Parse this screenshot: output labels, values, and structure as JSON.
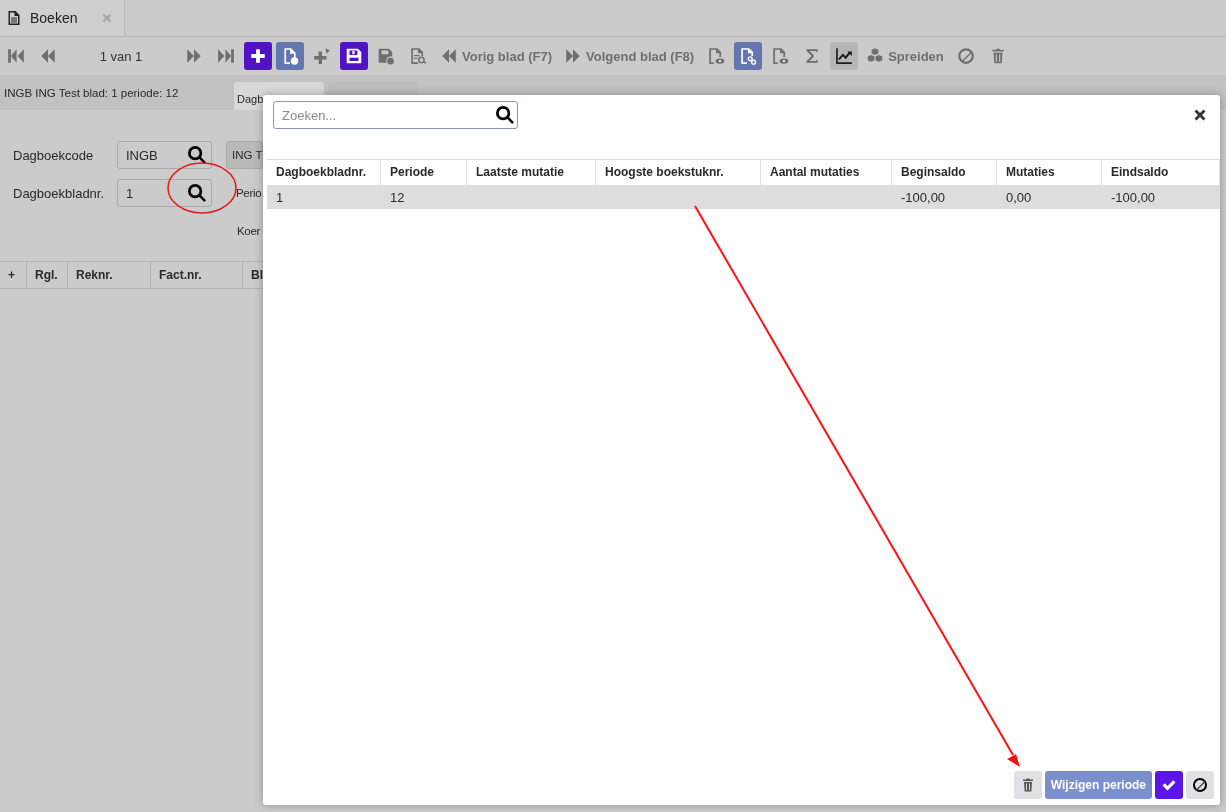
{
  "tab": {
    "label": "Boeken"
  },
  "toolbar": [
    {
      "kind": "icon",
      "disabled": true
    },
    {
      "kind": "icon",
      "disabled": true
    },
    {
      "kind": "counter",
      "label": "1 van 1"
    },
    {
      "kind": "icon",
      "disabled": true
    },
    {
      "kind": "icon",
      "disabled": true
    },
    {
      "kind": "icon",
      "disabled": false
    },
    {
      "kind": "icon",
      "disabled": false
    },
    {
      "kind": "icon",
      "disabled": true
    },
    {
      "kind": "icon",
      "disabled": false
    },
    {
      "kind": "icon",
      "disabled": true
    },
    {
      "kind": "icon",
      "disabled": true
    },
    {
      "kind": "labeled",
      "disabled": true,
      "label": "Vorig blad (F7)"
    },
    {
      "kind": "labeled",
      "disabled": true,
      "label": "Volgend blad (F8)"
    },
    {
      "kind": "icon",
      "disabled": true
    },
    {
      "kind": "icon",
      "disabled": false
    },
    {
      "kind": "icon",
      "disabled": true
    },
    {
      "kind": "icon",
      "disabled": true
    },
    {
      "kind": "icon",
      "disabled": false
    },
    {
      "kind": "labeled",
      "disabled": true,
      "label": "Spreiden"
    },
    {
      "kind": "icon",
      "disabled": true
    },
    {
      "kind": "icon",
      "disabled": true
    }
  ],
  "info": "INGB ING Test blad: 1 periode: 12",
  "page_tabs": [
    {
      "label": "Dagb",
      "selected": true
    },
    {
      "selected": false
    }
  ],
  "form": {
    "dagboekcode": {
      "label": "Dagboekcode",
      "value": "INGB"
    },
    "description": {
      "value": "ING T"
    },
    "dagboekbladnr": {
      "label": "Dagboekbladnr.",
      "value": "1"
    },
    "label_1": "Perio",
    "label_2": "Koer"
  },
  "grid": {
    "columns": [
      "+",
      "Rgl.",
      "Reknr.",
      "Fact.nr.",
      "Bl"
    ]
  },
  "modal": {
    "search": {
      "placeholder": "Zoeken..."
    },
    "columns": [
      "Dagboekbladnr.",
      "Periode",
      "Laatste mutatie",
      "Hoogste boekstuknr.",
      "Aantal mutaties",
      "Beginsaldo",
      "Mutaties",
      "Eindsaldo"
    ],
    "rows": [
      {
        "selected": true,
        "dagboekbladnr": "1",
        "periode": "12",
        "beginsaldo": "-100,00",
        "mutaties": "0,00",
        "eindsaldo": "-100,00"
      }
    ],
    "buttons": [
      {
        "kind": "delete"
      },
      {
        "kind": "text",
        "label": "Wijzigen periode"
      },
      {
        "kind": "confirm"
      },
      {
        "kind": "cancel"
      }
    ]
  }
}
